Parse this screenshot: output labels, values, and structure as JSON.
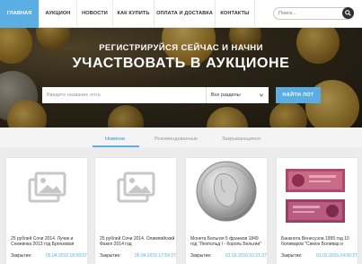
{
  "nav": {
    "items": [
      {
        "label": "ГЛАВНАЯ",
        "active": true
      },
      {
        "label": "АУКЦИОН",
        "active": false
      },
      {
        "label": "НОВОСТИ",
        "active": false
      },
      {
        "label": "КАК КУПИТЬ",
        "active": false
      },
      {
        "label": "ОПЛАТА И ДОСТАВКА",
        "active": false
      },
      {
        "label": "КОНТАКТЫ",
        "active": false
      }
    ],
    "search_placeholder": "Поиск..."
  },
  "hero": {
    "line1": "РЕГИСТРИРУЙСЯ СЕЙЧАС И НАЧНИ",
    "line2": "УЧАСТВОВАТЬ В АУКЦИОНЕ",
    "lot_placeholder": "Введите название лота",
    "section_value": "Все разделы",
    "find_label": "НАЙТИ ЛОТ"
  },
  "tabs": [
    {
      "label": "Новинки",
      "active": true
    },
    {
      "label": "Рекомендованные",
      "active": false
    },
    {
      "label": "Закрывающиеся",
      "active": false
    }
  ],
  "cards": [
    {
      "title": "25 рублей Сочи 2014. Лучик и Снежинка 2013 год Бронзовая",
      "close_label": "Закрытие:",
      "close_date": "05.04.2016 18:59:27",
      "image": "placeholder-image-icon"
    },
    {
      "title": "25 рублей Сочи 2014. Олимпийский Факел 2014 год",
      "close_label": "Закрытие:",
      "close_date": "05.04.2016 17:59:27",
      "image": "placeholder-image-icon"
    },
    {
      "title": "Монета Бельгия 5 франков 1849 год \"Леопольд I - Король Бельгии\"",
      "close_label": "Закрытие:",
      "close_date": "01.03.2016 02:21:27",
      "image": "silver-coin"
    },
    {
      "title": "Банкнота Венесуэла 1995 год 10 боливаров \"Симон Боливар и",
      "close_label": "Закрытие:",
      "close_date": "01.03.2016 04:06:27",
      "image": "banknotes"
    }
  ],
  "colors": {
    "accent": "#5aaee4",
    "dark": "#2f2f2f"
  }
}
